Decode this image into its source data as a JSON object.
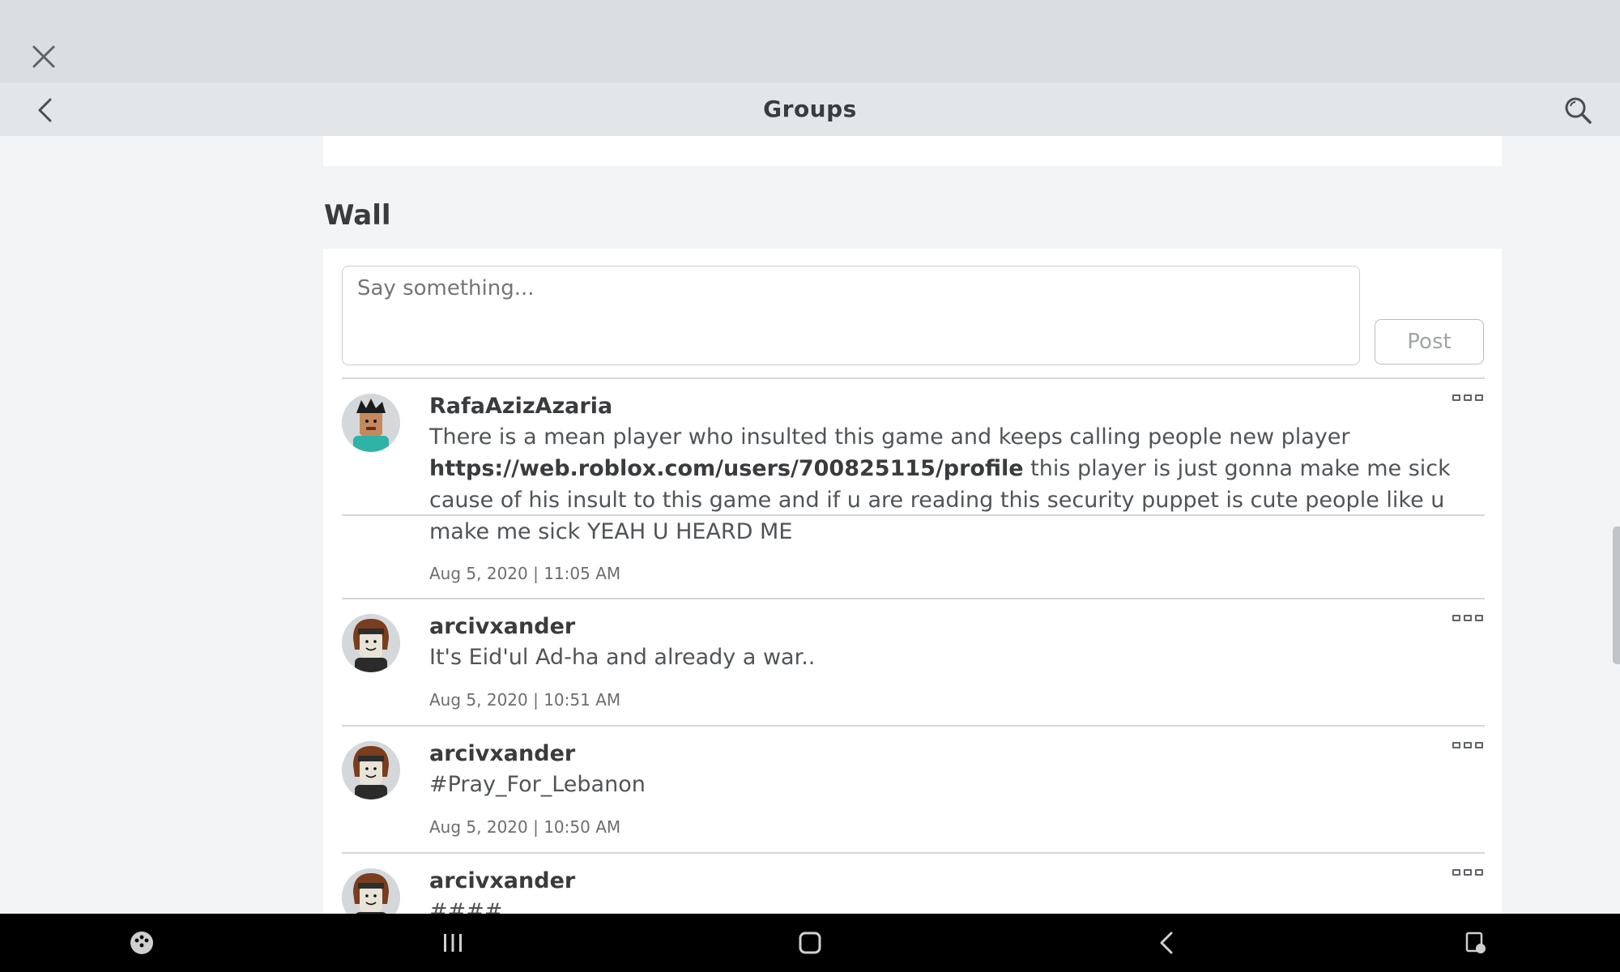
{
  "window": {
    "close_icon": "close-icon"
  },
  "nav": {
    "title": "Groups",
    "back_icon": "chevron-left-icon",
    "search_icon": "search-icon"
  },
  "wall": {
    "heading": "Wall",
    "composer_placeholder": "Say something...",
    "post_button": "Post",
    "posts": [
      {
        "user": "RafaAzizAzaria",
        "text_before": "There is a mean player who insulted this game and keeps calling people new player ",
        "link": "https://web.roblox.com/users/700825115/profile",
        "text_after": " this player is just gonna make me sick cause of his insult to this game and if u are reading this security puppet is cute people like u make me sick YEAH U HEARD ME",
        "time": "Aug 5, 2020 | 11:05 AM"
      },
      {
        "user": "arcivxander",
        "text": "It's Eid'ul Ad-ha and already a war..",
        "time": "Aug 5, 2020 | 10:51 AM"
      },
      {
        "user": "arcivxander",
        "text": "#Pray_For_Lebanon",
        "time": "Aug 5, 2020 | 10:50 AM"
      },
      {
        "user": "arcivxander",
        "text": "####"
      }
    ]
  },
  "system_nav": {
    "icons": [
      "game-launcher-icon",
      "recent-apps-icon",
      "home-icon",
      "back-icon",
      "screenshot-icon"
    ]
  },
  "colors": {
    "top_strip": "#dadee1",
    "nav_bar": "#e3e6e8",
    "page_bg": "#f2f4f5",
    "card_bg": "#ffffff",
    "text_primary": "#393b3d"
  }
}
